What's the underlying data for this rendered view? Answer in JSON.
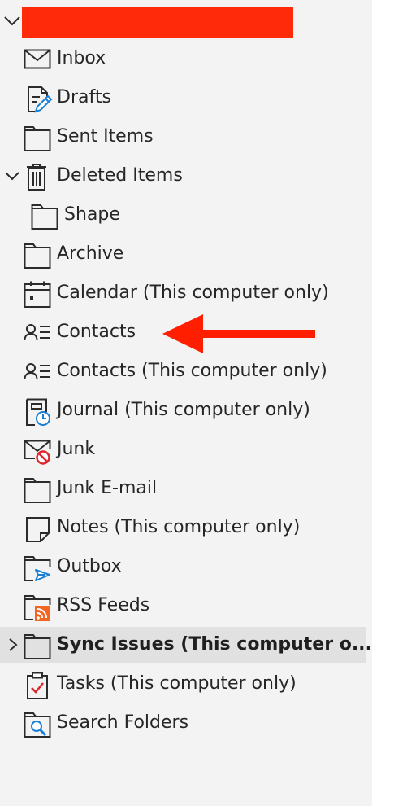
{
  "account": {
    "name": "(redacted account)",
    "redaction_color": "#ff2a09",
    "expanded": true
  },
  "folders": [
    {
      "label": "Inbox",
      "icon": "envelope-icon"
    },
    {
      "label": "Drafts",
      "icon": "drafts-pencil-icon"
    },
    {
      "label": "Sent Items",
      "icon": "folder-icon"
    },
    {
      "label": "Deleted Items",
      "icon": "trash-icon",
      "expanded": true
    },
    {
      "label": "Shape",
      "icon": "folder-icon",
      "subfolder_of": "Deleted Items"
    },
    {
      "label": "Archive",
      "icon": "folder-icon"
    },
    {
      "label": "Calendar (This computer only)",
      "icon": "calendar-icon"
    },
    {
      "label": "Contacts",
      "icon": "contacts-icon",
      "annotated": true
    },
    {
      "label": "Contacts (This computer only)",
      "icon": "contacts-icon"
    },
    {
      "label": "Journal (This computer only)",
      "icon": "journal-icon"
    },
    {
      "label": "Junk",
      "icon": "junk-envelope-icon"
    },
    {
      "label": "Junk E-mail",
      "icon": "folder-icon"
    },
    {
      "label": "Notes (This computer only)",
      "icon": "note-icon"
    },
    {
      "label": "Outbox",
      "icon": "outbox-icon"
    },
    {
      "label": "RSS Feeds",
      "icon": "rss-folder-icon"
    },
    {
      "label": "Sync Issues (This computer o...",
      "icon": "folder-icon",
      "collapsed": true,
      "selected": true,
      "bold": true
    },
    {
      "label": "Tasks (This computer only)",
      "icon": "tasks-clipboard-icon"
    },
    {
      "label": "Search Folders",
      "icon": "search-folder-icon"
    }
  ],
  "colors": {
    "pane_background": "#f3f3f3",
    "selected_row": "#e1e1e1",
    "text": "#262626",
    "icon_stroke": "#2b2b2b",
    "accent_blue": "#1a7fd6",
    "annotation_arrow": "#ff1e00",
    "junk_red": "#e0242c",
    "rss_orange": "#f26522"
  },
  "annotation": {
    "type": "arrow",
    "points_to": "Contacts",
    "icon": "arrow-left-icon"
  }
}
